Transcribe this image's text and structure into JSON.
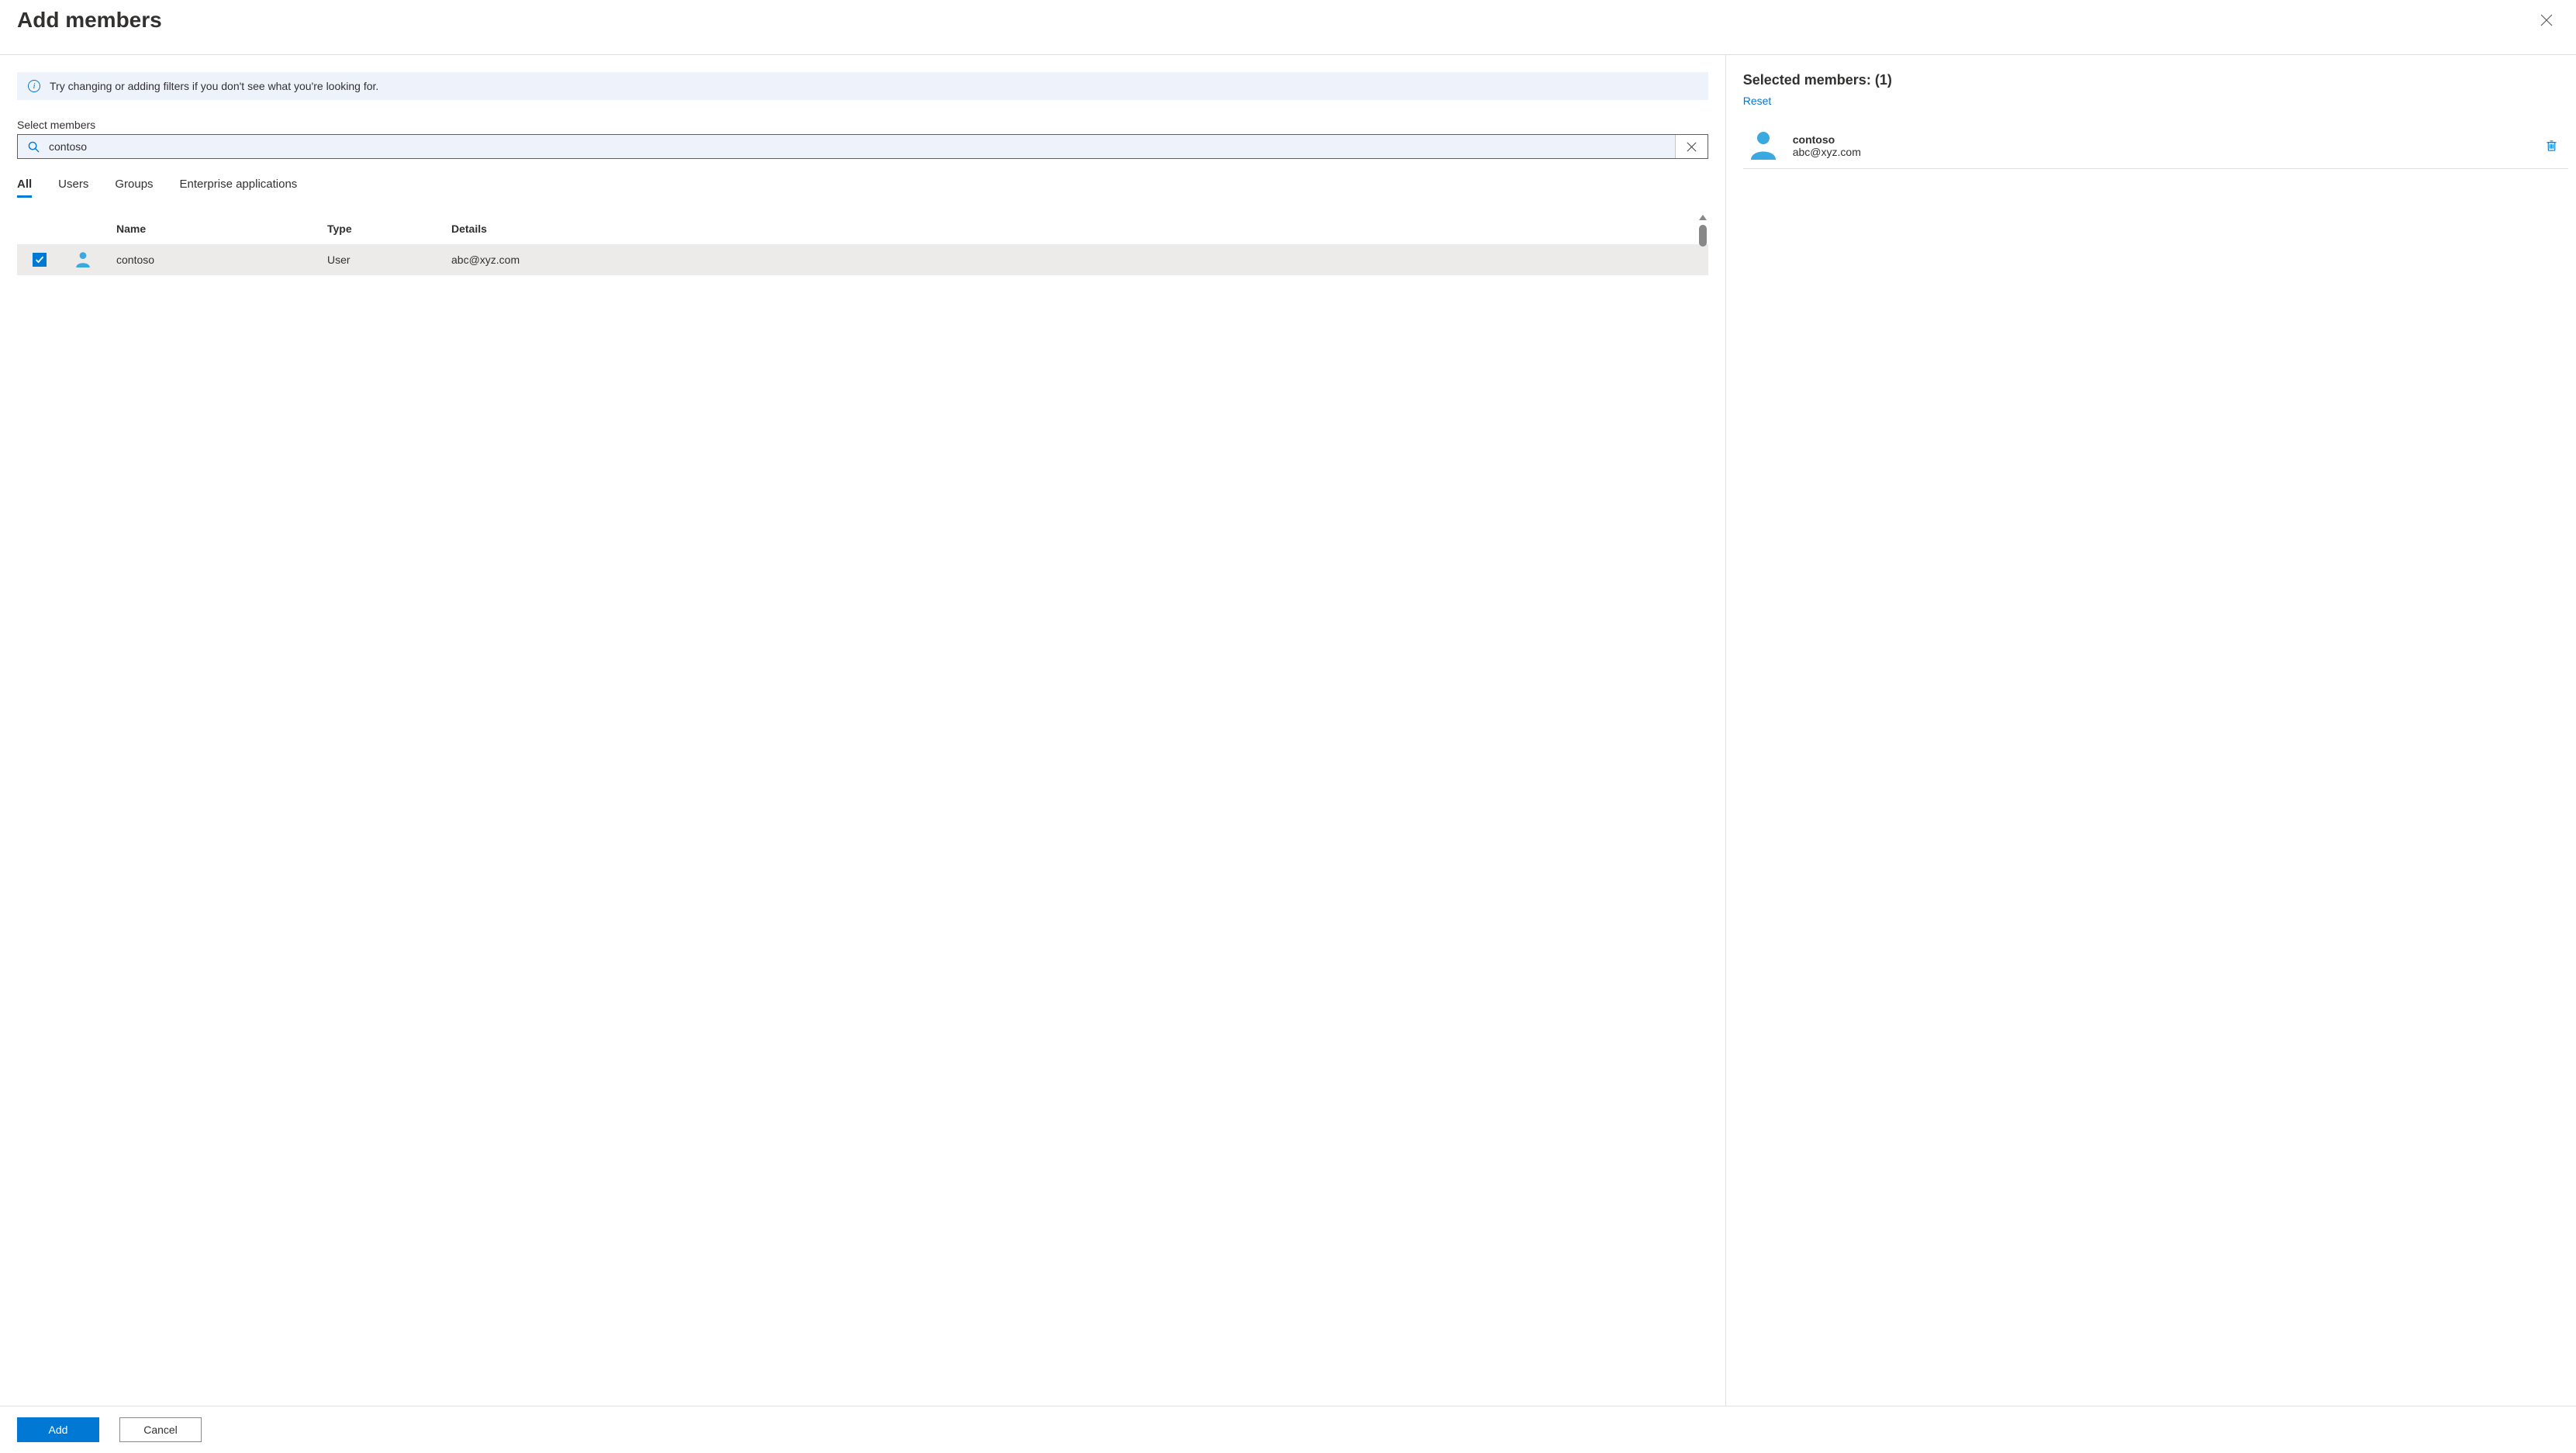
{
  "header": {
    "title": "Add members"
  },
  "info_banner": "Try changing or adding filters if you don't see what you're looking for.",
  "search": {
    "label": "Select members",
    "value": "contoso",
    "placeholder": ""
  },
  "tabs": [
    {
      "label": "All",
      "active": true
    },
    {
      "label": "Users",
      "active": false
    },
    {
      "label": "Groups",
      "active": false
    },
    {
      "label": "Enterprise applications",
      "active": false
    }
  ],
  "columns": {
    "name": "Name",
    "type": "Type",
    "details": "Details"
  },
  "results": [
    {
      "name": "contoso",
      "type": "User",
      "details": "abc@xyz.com",
      "checked": true
    }
  ],
  "selected": {
    "header_prefix": "Selected members:",
    "count": 1,
    "reset_label": "Reset",
    "items": [
      {
        "name": "contoso",
        "details": "abc@xyz.com"
      }
    ]
  },
  "footer": {
    "add": "Add",
    "cancel": "Cancel"
  }
}
